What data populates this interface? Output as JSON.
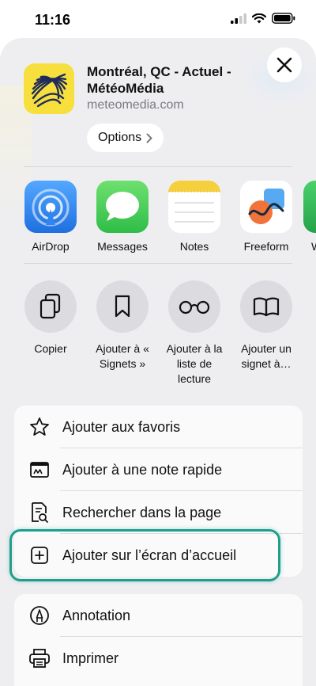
{
  "status_bar": {
    "time": "11:16"
  },
  "header": {
    "title": "Montréal, QC - Actuel - MétéoMédia",
    "subtitle": "meteomedia.com",
    "options_label": "Options"
  },
  "apps": [
    {
      "label": "AirDrop",
      "icon": "airdrop-icon"
    },
    {
      "label": "Messages",
      "icon": "messages-icon"
    },
    {
      "label": "Notes",
      "icon": "notes-icon"
    },
    {
      "label": "Freeform",
      "icon": "freeform-icon"
    },
    {
      "label": "W",
      "icon": "partial-app-icon"
    }
  ],
  "actions": [
    {
      "label": "Copier",
      "icon": "copy-icon"
    },
    {
      "label": "Ajouter à « Signets »",
      "icon": "bookmark-icon"
    },
    {
      "label": "Ajouter à la liste de lecture",
      "icon": "glasses-icon"
    },
    {
      "label": "Ajouter un signet à…",
      "icon": "book-icon"
    }
  ],
  "menu_group_1": [
    {
      "label": "Ajouter aux favoris",
      "icon": "star-icon"
    },
    {
      "label": "Ajouter à une note rapide",
      "icon": "quick-note-icon"
    },
    {
      "label": "Rechercher dans la page",
      "icon": "find-in-page-icon"
    },
    {
      "label": "Ajouter sur l’écran d’accueil",
      "icon": "add-square-icon"
    }
  ],
  "menu_group_2": [
    {
      "label": "Annotation",
      "icon": "markup-icon"
    },
    {
      "label": "Imprimer",
      "icon": "printer-icon"
    }
  ],
  "colors": {
    "highlight": "#1f9e8c",
    "airdrop": "#2f86f0",
    "messages": "#34c759",
    "notes_top": "#f6cf3c",
    "app_icon_bg": "#f7df3e"
  }
}
